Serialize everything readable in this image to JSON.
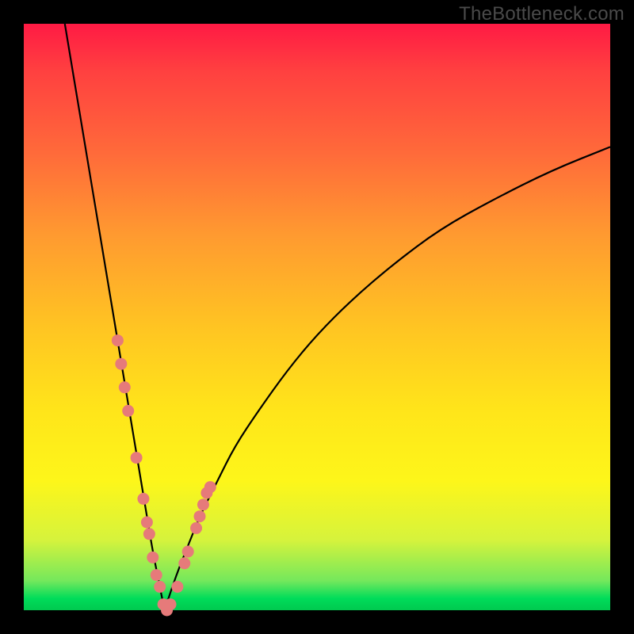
{
  "watermark": "TheBottleneck.com",
  "colors": {
    "curve_stroke": "#000000",
    "marker_fill": "#e67a7a",
    "marker_stroke": "#cc5a5a",
    "bg_black": "#000000"
  },
  "chart_data": {
    "type": "line",
    "title": "",
    "xlabel": "",
    "ylabel": "",
    "xlim": [
      0,
      100
    ],
    "ylim": [
      0,
      100
    ],
    "note": "Two curves descending to a common minimum near x≈24; y is the absolute-value/bottleneck metric. Values approximate from pixel positions.",
    "series": [
      {
        "name": "left_curve",
        "x": [
          7,
          9,
          11,
          13,
          15,
          17,
          19,
          20,
          21,
          22,
          23,
          24
        ],
        "y": [
          100,
          88,
          76,
          64,
          52,
          40,
          28,
          22,
          16,
          10,
          5,
          0
        ]
      },
      {
        "name": "right_curve",
        "x": [
          24,
          26,
          28,
          30,
          33,
          36,
          40,
          45,
          50,
          56,
          63,
          71,
          80,
          90,
          100
        ],
        "y": [
          0,
          6,
          11,
          16,
          22,
          28,
          34,
          41,
          47,
          53,
          59,
          65,
          70,
          75,
          79
        ]
      }
    ],
    "markers": {
      "name": "highlighted_points",
      "points": [
        {
          "x": 16.0,
          "y": 46
        },
        {
          "x": 16.6,
          "y": 42
        },
        {
          "x": 17.2,
          "y": 38
        },
        {
          "x": 17.8,
          "y": 34
        },
        {
          "x": 19.2,
          "y": 26
        },
        {
          "x": 20.4,
          "y": 19
        },
        {
          "x": 21.0,
          "y": 15
        },
        {
          "x": 21.4,
          "y": 13
        },
        {
          "x": 22.0,
          "y": 9
        },
        {
          "x": 22.6,
          "y": 6
        },
        {
          "x": 23.2,
          "y": 4
        },
        {
          "x": 23.8,
          "y": 1
        },
        {
          "x": 24.4,
          "y": 0
        },
        {
          "x": 25.0,
          "y": 1
        },
        {
          "x": 26.2,
          "y": 4
        },
        {
          "x": 27.4,
          "y": 8
        },
        {
          "x": 28.0,
          "y": 10
        },
        {
          "x": 29.4,
          "y": 14
        },
        {
          "x": 30.0,
          "y": 16
        },
        {
          "x": 30.6,
          "y": 18
        },
        {
          "x": 31.2,
          "y": 20
        },
        {
          "x": 31.8,
          "y": 21
        }
      ]
    }
  }
}
